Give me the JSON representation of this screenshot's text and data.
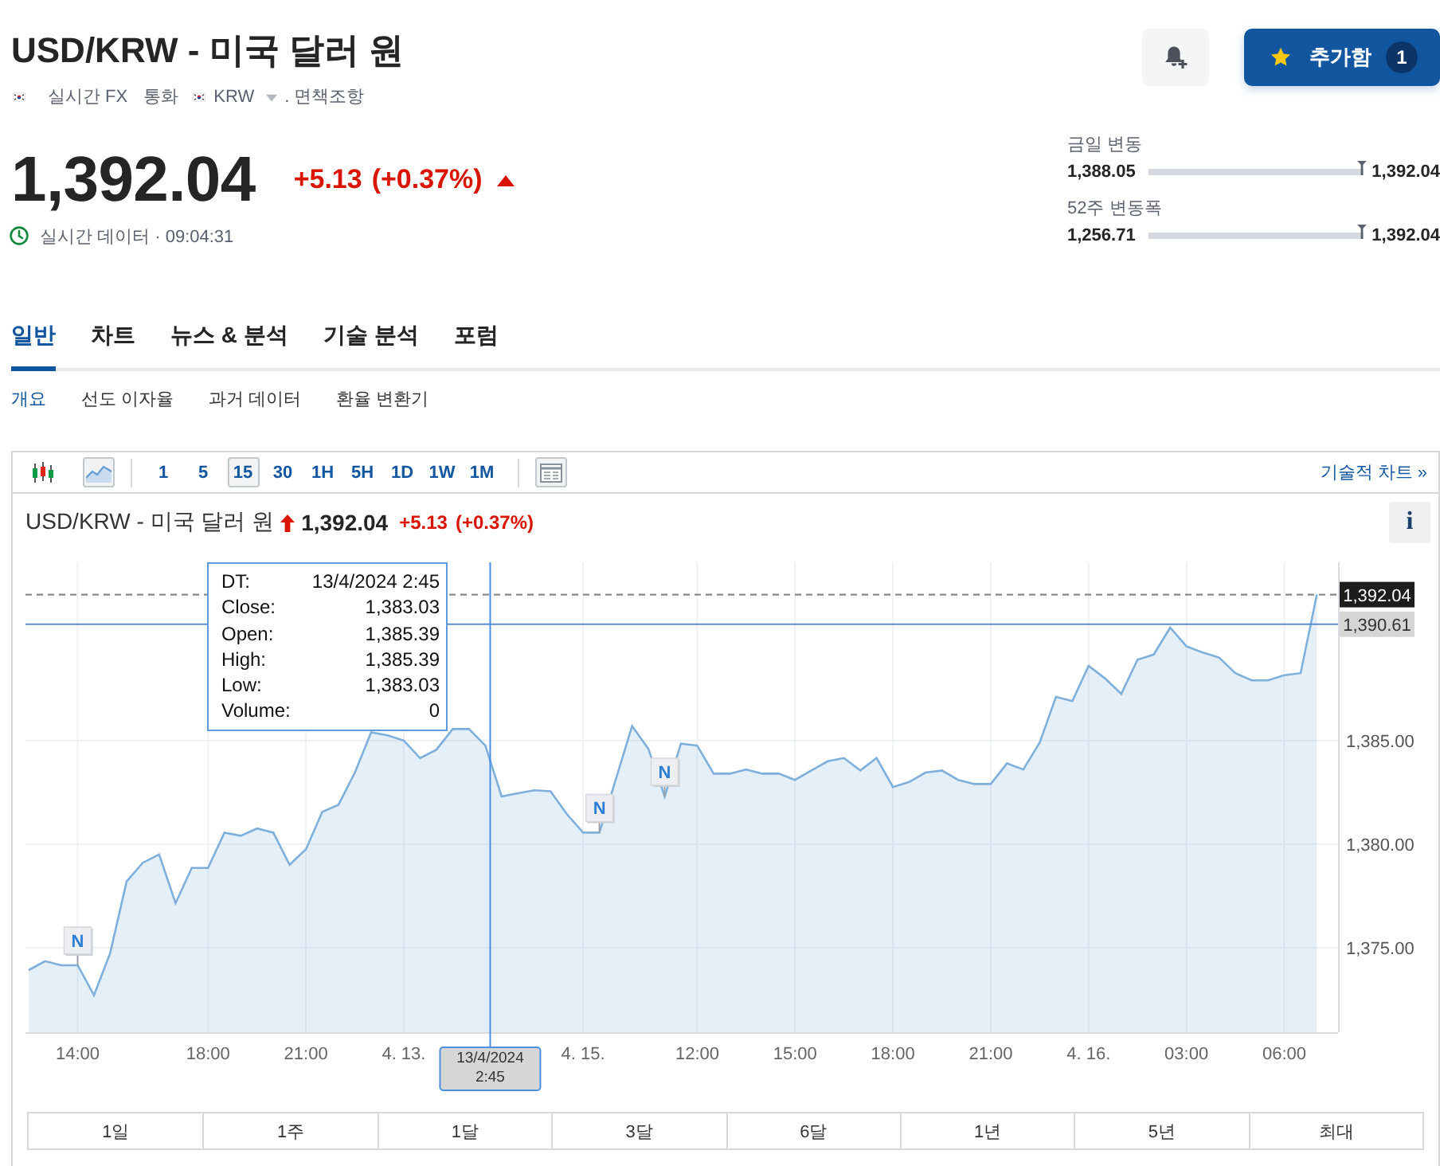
{
  "header": {
    "title": "USD/KRW - 미국 달러 원",
    "meta": {
      "market": "실시간 FX",
      "category": "통화",
      "currency": "KRW",
      "disclaimer": ". 면책조항"
    },
    "price": "1,392.04",
    "change": "+5.13",
    "change_pct": "(+0.37%)",
    "rising": true,
    "status": "실시간 데이터 · 09:04:31"
  },
  "watchlist_button": {
    "label": "추가함",
    "count": "1"
  },
  "ranges": [
    {
      "label": "금일 변동",
      "low": "1,388.05",
      "high": "1,392.04",
      "level": 1
    },
    {
      "label": "52주 변동폭",
      "low": "1,256.71",
      "high": "1,392.04",
      "level": 1
    }
  ],
  "tabs": [
    {
      "label": "일반",
      "selected": true
    },
    {
      "label": "차트",
      "selected": false
    },
    {
      "label": "뉴스 & 분석",
      "selected": false
    },
    {
      "label": "기술 분석",
      "selected": false
    },
    {
      "label": "포럼",
      "selected": false
    }
  ],
  "subtabs": [
    {
      "label": "개요",
      "selected": true
    },
    {
      "label": "선도 이자율",
      "selected": false
    },
    {
      "label": "과거 데이터",
      "selected": false
    },
    {
      "label": "환율 변환기",
      "selected": false
    }
  ],
  "chart": {
    "chart_types": [
      {
        "kind": "candlestick",
        "selected": false
      },
      {
        "kind": "area",
        "selected": true
      }
    ],
    "intervals": [
      {
        "label": "1",
        "selected": false
      },
      {
        "label": "5",
        "selected": false
      },
      {
        "label": "15",
        "selected": true
      },
      {
        "label": "30",
        "selected": false
      },
      {
        "label": "1H",
        "selected": false
      },
      {
        "label": "5H",
        "selected": false
      },
      {
        "label": "1D",
        "selected": false
      },
      {
        "label": "1W",
        "selected": false
      },
      {
        "label": "1M",
        "selected": false
      }
    ],
    "advanced_link": "기술적 차트 »",
    "price": "1,392.04",
    "change": "+5.13",
    "change_pct": "(+0.37%)",
    "rising": true,
    "info": "i",
    "tooltip": [
      {
        "label": "DT:",
        "value": "13/4/2024 2:45"
      },
      {
        "label": "Close:",
        "value": "1,383.03"
      },
      {
        "label": "Open:",
        "value": "1,385.39"
      },
      {
        "label": "High:",
        "value": "1,385.39"
      },
      {
        "label": "Low:",
        "value": "1,383.03"
      },
      {
        "label": "Volume:",
        "value": "0"
      }
    ],
    "news_markers": [
      "N",
      "N",
      "N"
    ],
    "crosshair_time": "13/4/2024 2:45",
    "chart_data": {
      "type": "area",
      "title": "USD/KRW - 미국 달러 원",
      "grid": true,
      "categories": [
        null,
        null,
        null,
        "14:00",
        null,
        null,
        null,
        null,
        null,
        null,
        null,
        "18:00",
        null,
        null,
        null,
        null,
        null,
        "21:00",
        null,
        null,
        null,
        null,
        null,
        "4. 13.",
        null,
        null,
        null,
        null,
        null,
        null,
        null,
        null,
        null,
        null,
        "4. 15.",
        null,
        null,
        null,
        null,
        null,
        null,
        "12:00",
        null,
        null,
        null,
        null,
        null,
        "15:00",
        null,
        null,
        null,
        null,
        null,
        "18:00",
        null,
        null,
        null,
        null,
        null,
        "21:00",
        null,
        null,
        null,
        null,
        null,
        "4. 16.",
        null,
        null,
        null,
        null,
        null,
        "03:00",
        null,
        null,
        null,
        null,
        null,
        "06:00",
        null,
        null
      ],
      "series": [
        {
          "color": "#7fb0dc",
          "values": [
            1373.92,
            1374.35,
            1374.15,
            1374.15,
            1372.7,
            1374.75,
            1378.2,
            1379.1,
            1379.5,
            1377.15,
            1378.85,
            1378.85,
            1380.55,
            1380.4,
            1380.75,
            1380.55,
            1379.0,
            1379.75,
            1381.55,
            1381.9,
            1383.45,
            1385.4,
            1385.25,
            1385.0,
            1384.15,
            1384.55,
            1385.55,
            1385.55,
            1384.75,
            1382.3,
            1382.45,
            1382.6,
            1382.55,
            1381.45,
            1380.55,
            1380.55,
            1383.1,
            1385.7,
            1384.6,
            1382.3,
            1384.85,
            1384.75,
            1383.4,
            1383.4,
            1383.6,
            1383.4,
            1383.4,
            1383.1,
            1383.55,
            1384.0,
            1384.15,
            1383.55,
            1384.15,
            1382.75,
            1383.0,
            1383.45,
            1383.55,
            1383.1,
            1382.9,
            1382.9,
            1383.9,
            1383.6,
            1384.9,
            1387.1,
            1386.9,
            1388.6,
            1388.0,
            1387.25,
            1388.9,
            1389.15,
            1390.45,
            1389.55,
            1389.25,
            1389.0,
            1388.25,
            1387.9,
            1387.9,
            1388.15,
            1388.25,
            1392.04
          ]
        }
      ],
      "ylim": [
        1370.92,
        1393.6
      ],
      "yticks": [
        {
          "value": 1375,
          "label": "1,375.00"
        },
        {
          "value": 1380,
          "label": "1,380.00"
        },
        {
          "value": 1385,
          "label": "1,385.00"
        }
      ],
      "ref_lines": [
        {
          "axis": "y",
          "value": 1392.04,
          "label": "1,392.04"
        },
        {
          "axis": "y",
          "value": 1390.61,
          "label": "1,390.61"
        }
      ]
    },
    "periods": [
      "1일",
      "1주",
      "1달",
      "3달",
      "6달",
      "1년",
      "5년",
      "최대"
    ]
  }
}
